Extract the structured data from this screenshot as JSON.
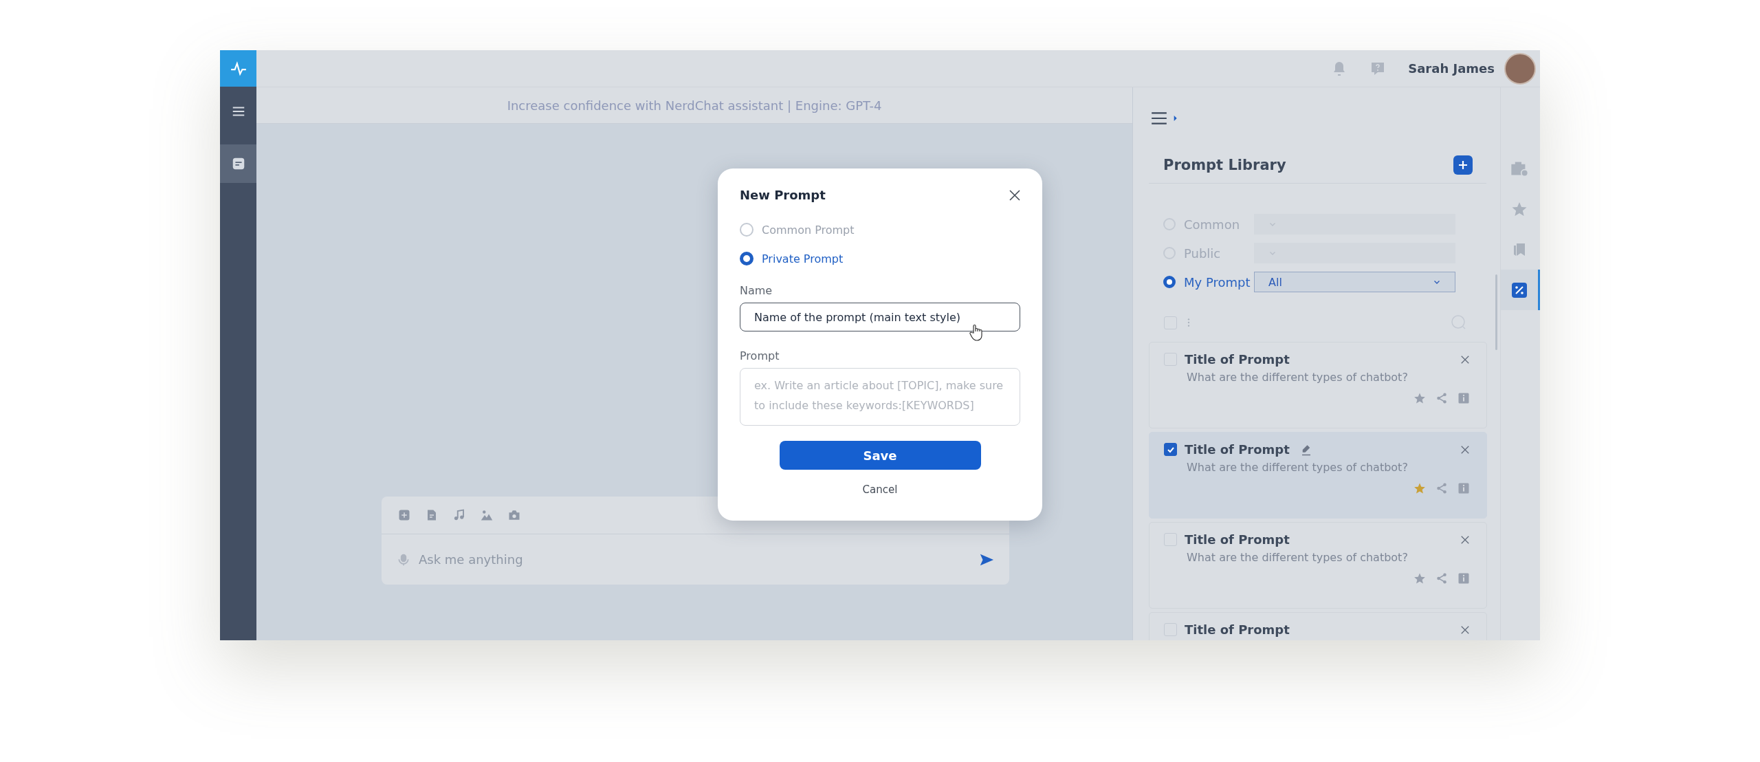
{
  "nav_rail": {
    "items": [
      {
        "kind": "menu",
        "selected": false
      },
      {
        "kind": "chat",
        "selected": true
      }
    ]
  },
  "top_bar": {
    "user_name": "Sarah James"
  },
  "subheader": "Increase confidence with NerdChat assistant | Engine: GPT-4",
  "composer": {
    "placeholder": "Ask me anything"
  },
  "dialog": {
    "title": "New Prompt",
    "options": [
      {
        "label": "Common Prompt",
        "selected": false
      },
      {
        "label": "Private Prompt",
        "selected": true
      }
    ],
    "name_label": "Name",
    "name_value": "Name of the prompt (main text style)",
    "prompt_label": "Prompt",
    "prompt_placeholder": "ex. Write an article about [TOPIC], make sure to include these keywords:[KEYWORDS]",
    "save": "Save",
    "cancel": "Cancel"
  },
  "prompt_library": {
    "title": "Prompt Library",
    "filters": [
      {
        "label": "Common",
        "selected": false
      },
      {
        "label": "Public",
        "selected": false
      },
      {
        "label": "My Prompt",
        "selected": true,
        "value": "All"
      }
    ],
    "select_all_checked": false,
    "prompts": [
      {
        "title": "Title of Prompt",
        "description": "What are the different types of chatbot?",
        "checked": false,
        "favorite": false,
        "editable": false
      },
      {
        "title": "Title of Prompt",
        "description": "What are the different types of chatbot?",
        "checked": true,
        "favorite": true,
        "editable": true
      },
      {
        "title": "Title of Prompt",
        "description": "What are the different types of chatbot?",
        "checked": false,
        "favorite": false,
        "editable": false
      },
      {
        "title": "Title of Prompt",
        "checked": false
      }
    ]
  },
  "right_rail": {
    "items": [
      {
        "kind": "briefcase",
        "selected": false
      },
      {
        "kind": "star",
        "selected": false
      },
      {
        "kind": "bookmarks",
        "selected": false
      },
      {
        "kind": "percent",
        "selected": true
      }
    ]
  }
}
